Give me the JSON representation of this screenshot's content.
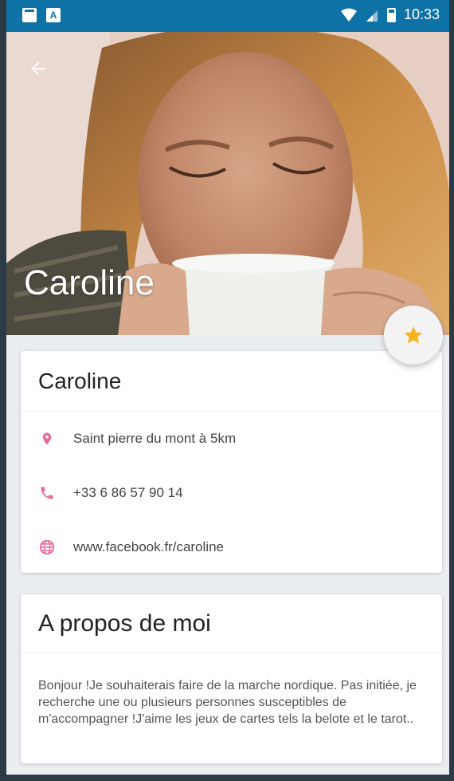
{
  "status_bar": {
    "time": "10:33",
    "app_icon_letter": "A",
    "icons": [
      "sd-card-icon",
      "app-icon",
      "wifi-icon",
      "signal-icon",
      "battery-icon"
    ]
  },
  "hero": {
    "title": "Caroline",
    "back_icon": "arrow-back-icon"
  },
  "favorite": {
    "icon": "star-icon",
    "color": "#f5b51c"
  },
  "profile_card": {
    "name": "Caroline",
    "location": "Saint pierre du mont à 5km",
    "phone": "+33 6 86 57 90 14",
    "website": "www.facebook.fr/caroline",
    "icon_color": "#e96a9c"
  },
  "about_card": {
    "title": "A propos de moi",
    "text": "Bonjour !Je souhaiterais faire de la marche nordique. Pas initiée, je recherche une ou plusieurs personnes susceptibles de m'accompagner !J'aime les jeux de cartes tels la belote et le tarot.."
  },
  "colors": {
    "status_bar": "#0f72a6",
    "background": "#eaeef0",
    "frame": "#2b3a44"
  }
}
